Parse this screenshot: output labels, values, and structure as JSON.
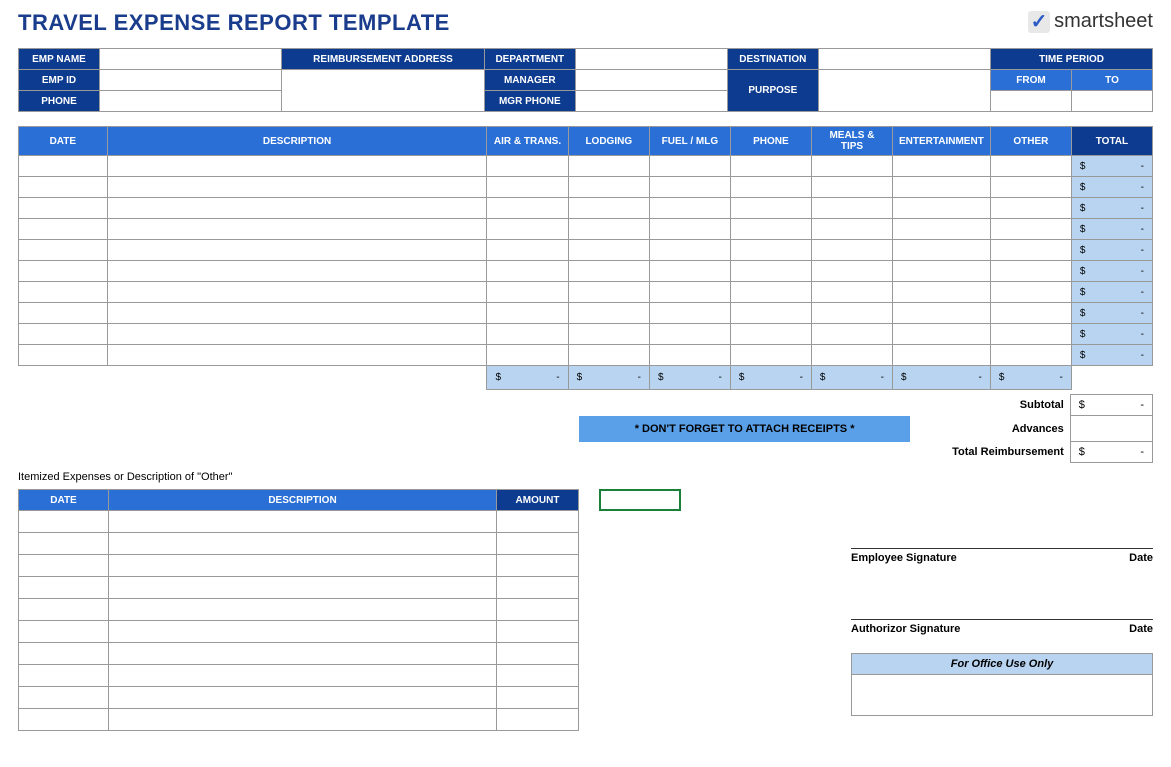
{
  "title": "TRAVEL EXPENSE REPORT TEMPLATE",
  "logo": {
    "brand": "smartsheet"
  },
  "info": {
    "emp_name_label": "EMP NAME",
    "emp_id_label": "EMP ID",
    "phone_label": "PHONE",
    "reimb_addr_label": "REIMBURSEMENT ADDRESS",
    "department_label": "DEPARTMENT",
    "manager_label": "MANAGER",
    "mgr_phone_label": "MGR PHONE",
    "destination_label": "DESTINATION",
    "purpose_label": "PURPOSE",
    "time_period_label": "TIME PERIOD",
    "from_label": "FROM",
    "to_label": "TO",
    "emp_name": "",
    "emp_id": "",
    "phone": "",
    "reimb_addr": "",
    "department": "",
    "manager": "",
    "mgr_phone": "",
    "destination": "",
    "purpose": "",
    "from": "",
    "to": ""
  },
  "expense_headers": {
    "date": "DATE",
    "description": "DESCRIPTION",
    "air": "AIR & TRANS.",
    "lodging": "LODGING",
    "fuel": "FUEL / MLG",
    "phone": "PHONE",
    "meals": "MEALS & TIPS",
    "ent": "ENTERTAINMENT",
    "other": "OTHER",
    "total": "TOTAL"
  },
  "expense_rows": [
    {
      "date": "",
      "desc": "",
      "air": "",
      "lodging": "",
      "fuel": "",
      "phone": "",
      "meals": "",
      "ent": "",
      "other": "",
      "cur": "$",
      "dash": "-"
    },
    {
      "date": "",
      "desc": "",
      "air": "",
      "lodging": "",
      "fuel": "",
      "phone": "",
      "meals": "",
      "ent": "",
      "other": "",
      "cur": "$",
      "dash": "-"
    },
    {
      "date": "",
      "desc": "",
      "air": "",
      "lodging": "",
      "fuel": "",
      "phone": "",
      "meals": "",
      "ent": "",
      "other": "",
      "cur": "$",
      "dash": "-"
    },
    {
      "date": "",
      "desc": "",
      "air": "",
      "lodging": "",
      "fuel": "",
      "phone": "",
      "meals": "",
      "ent": "",
      "other": "",
      "cur": "$",
      "dash": "-"
    },
    {
      "date": "",
      "desc": "",
      "air": "",
      "lodging": "",
      "fuel": "",
      "phone": "",
      "meals": "",
      "ent": "",
      "other": "",
      "cur": "$",
      "dash": "-"
    },
    {
      "date": "",
      "desc": "",
      "air": "",
      "lodging": "",
      "fuel": "",
      "phone": "",
      "meals": "",
      "ent": "",
      "other": "",
      "cur": "$",
      "dash": "-"
    },
    {
      "date": "",
      "desc": "",
      "air": "",
      "lodging": "",
      "fuel": "",
      "phone": "",
      "meals": "",
      "ent": "",
      "other": "",
      "cur": "$",
      "dash": "-"
    },
    {
      "date": "",
      "desc": "",
      "air": "",
      "lodging": "",
      "fuel": "",
      "phone": "",
      "meals": "",
      "ent": "",
      "other": "",
      "cur": "$",
      "dash": "-"
    },
    {
      "date": "",
      "desc": "",
      "air": "",
      "lodging": "",
      "fuel": "",
      "phone": "",
      "meals": "",
      "ent": "",
      "other": "",
      "cur": "$",
      "dash": "-"
    },
    {
      "date": "",
      "desc": "",
      "air": "",
      "lodging": "",
      "fuel": "",
      "phone": "",
      "meals": "",
      "ent": "",
      "other": "",
      "cur": "$",
      "dash": "-"
    }
  ],
  "col_totals": {
    "air": {
      "cur": "$",
      "dash": "-"
    },
    "lodging": {
      "cur": "$",
      "dash": "-"
    },
    "fuel": {
      "cur": "$",
      "dash": "-"
    },
    "phone": {
      "cur": "$",
      "dash": "-"
    },
    "meals": {
      "cur": "$",
      "dash": "-"
    },
    "ent": {
      "cur": "$",
      "dash": "-"
    },
    "other": {
      "cur": "$",
      "dash": "-"
    }
  },
  "receipts_note": "* DON'T FORGET TO ATTACH RECEIPTS *",
  "summary": {
    "subtotal_label": "Subtotal",
    "subtotal_cur": "$",
    "subtotal_dash": "-",
    "advances_label": "Advances",
    "advances_val": "",
    "reimb_label": "Total Reimbursement",
    "reimb_cur": "$",
    "reimb_dash": "-"
  },
  "itemized": {
    "caption": "Itemized Expenses or Description of \"Other\"",
    "headers": {
      "date": "DATE",
      "description": "DESCRIPTION",
      "amount": "AMOUNT"
    },
    "rows": [
      {
        "date": "",
        "desc": "",
        "amount": ""
      },
      {
        "date": "",
        "desc": "",
        "amount": ""
      },
      {
        "date": "",
        "desc": "",
        "amount": ""
      },
      {
        "date": "",
        "desc": "",
        "amount": ""
      },
      {
        "date": "",
        "desc": "",
        "amount": ""
      },
      {
        "date": "",
        "desc": "",
        "amount": ""
      },
      {
        "date": "",
        "desc": "",
        "amount": ""
      },
      {
        "date": "",
        "desc": "",
        "amount": ""
      },
      {
        "date": "",
        "desc": "",
        "amount": ""
      },
      {
        "date": "",
        "desc": "",
        "amount": ""
      }
    ]
  },
  "signatures": {
    "employee_label": "Employee Signature",
    "authorizor_label": "Authorizor Signature",
    "date_label": "Date"
  },
  "office": {
    "header": "For Office Use Only"
  }
}
